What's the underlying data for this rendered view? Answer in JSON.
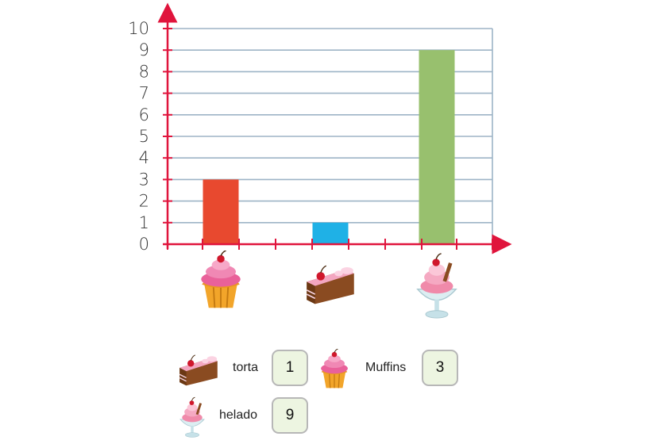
{
  "chart_data": {
    "type": "bar",
    "categories": [
      "Muffins",
      "torta",
      "helado"
    ],
    "category_icons": [
      "cupcake-icon",
      "cake-slice-icon",
      "ice-cream-sundae-icon"
    ],
    "values": [
      3,
      1,
      9
    ],
    "bar_colors": [
      "#e8492f",
      "#1fb1e6",
      "#98c06e"
    ],
    "ylim": [
      0,
      10
    ],
    "yticks": [
      "0",
      "1",
      "2",
      "3",
      "4",
      "5",
      "6",
      "7",
      "8",
      "9",
      "10"
    ],
    "grid": true,
    "axis_color": "#e0143c",
    "grid_color": "#9db4c6"
  },
  "legend": {
    "items": [
      {
        "label": "torta",
        "value": "1",
        "icon": "cake-slice-icon"
      },
      {
        "label": "Muffins",
        "value": "3",
        "icon": "cupcake-icon"
      },
      {
        "label": "helado",
        "value": "9",
        "icon": "ice-cream-sundae-icon"
      }
    ]
  }
}
